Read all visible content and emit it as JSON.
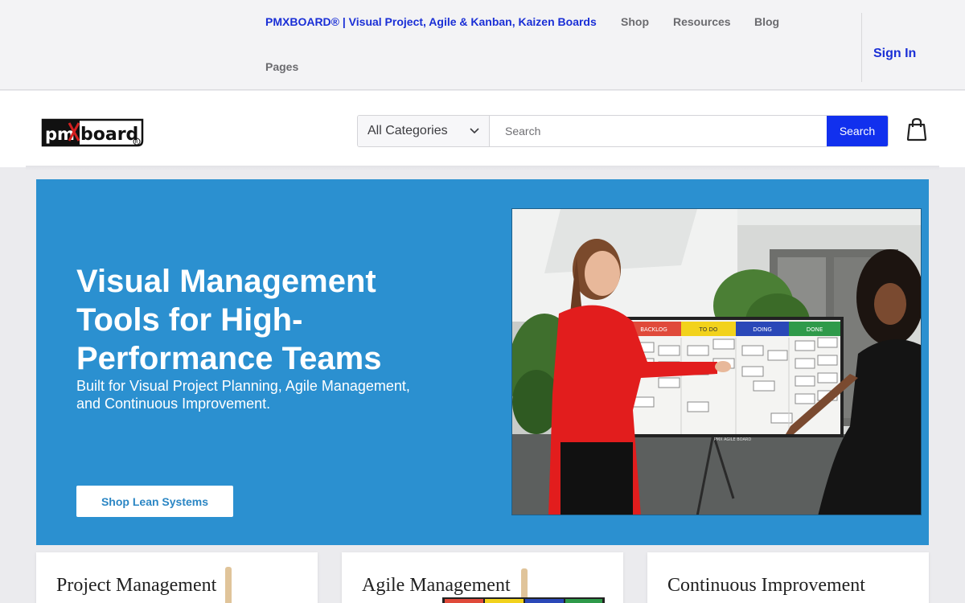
{
  "topnav": {
    "brand": "PMXBOARD® | Visual Project, Agile & Kanban, Kaizen Boards",
    "links": [
      "Shop",
      "Resources",
      "Blog"
    ],
    "pages": "Pages",
    "signin": "Sign In"
  },
  "header": {
    "logo_alt": "pmxboard",
    "category_select": "All Categories",
    "search_placeholder": "Search",
    "search_button": "Search",
    "cart_icon": "shopping-bag-icon"
  },
  "hero": {
    "title": "Visual Management Tools for High-Performance Teams",
    "subtitle": "Built for Visual Project Planning, Agile Management, and Continuous Improvement.",
    "cta": "Shop Lean Systems",
    "board_columns": [
      "BACKLOG",
      "TO DO",
      "DOING",
      "DONE"
    ],
    "board_brand": "PMX AGILE BOARD",
    "background_color": "#2b90d0"
  },
  "cards": [
    {
      "title": "Project Management"
    },
    {
      "title": "Agile Management"
    },
    {
      "title": "Continuous Improvement"
    }
  ],
  "colors": {
    "brand_blue": "#1a2fd6",
    "button_blue": "#1130ee",
    "hero_blue": "#2b90d0"
  }
}
